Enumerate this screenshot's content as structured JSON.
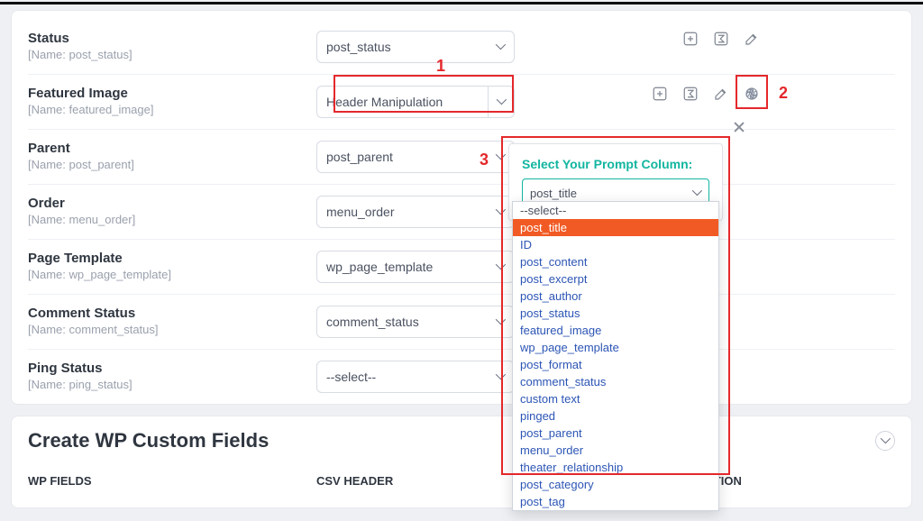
{
  "rows": [
    {
      "label": "Status",
      "name": "post_status",
      "value": "post_status"
    },
    {
      "label": "Featured Image",
      "name": "featured_image",
      "value": "Header Manipulation"
    },
    {
      "label": "Parent",
      "name": "post_parent",
      "value": "post_parent"
    },
    {
      "label": "Order",
      "name": "menu_order",
      "value": "menu_order"
    },
    {
      "label": "Page Template",
      "name": "wp_page_template",
      "value": "wp_page_template"
    },
    {
      "label": "Comment Status",
      "name": "comment_status",
      "value": "comment_status"
    },
    {
      "label": "Ping Status",
      "name": "ping_status",
      "value": "--select--"
    }
  ],
  "name_prefix": "[Name: ",
  "name_suffix": "]",
  "popup": {
    "title": "Select Your Prompt Column:",
    "value": "post_title",
    "options": [
      "--select--",
      "post_title",
      "ID",
      "post_content",
      "post_excerpt",
      "post_author",
      "post_status",
      "featured_image",
      "wp_page_template",
      "post_format",
      "comment_status",
      "custom text",
      "pinged",
      "post_parent",
      "menu_order",
      "theater_relationship",
      "post_category",
      "post_tag"
    ],
    "selected_index": 1
  },
  "annotations": {
    "n1": "1",
    "n2": "2",
    "n3": "3"
  },
  "section2": {
    "title": "Create WP Custom Fields",
    "col1": "WP FIELDS",
    "col2": "CSV HEADER",
    "col3": "ACTION"
  },
  "icons": [
    "plus",
    "sigma",
    "edit",
    "openai"
  ]
}
